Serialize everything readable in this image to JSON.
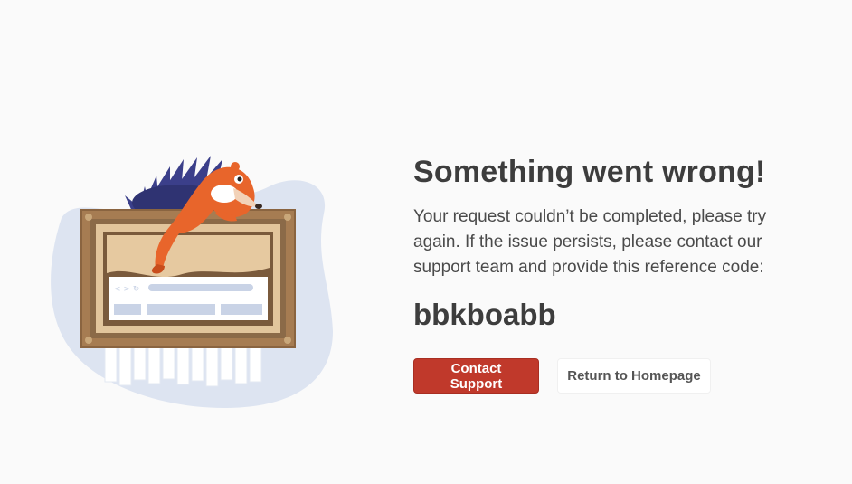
{
  "error": {
    "title": "Something went wrong!",
    "message": "Your request couldn’t be completed, please try again. If the issue persists, please contact our support team and provide this reference code:",
    "reference_code": "bbkboabb"
  },
  "actions": {
    "contact_support_label": "Contact Support",
    "return_home_label": "Return to Homepage"
  },
  "colors": {
    "background": "#fafafa",
    "primary_button": "#c0392b",
    "hedgehog_body": "#e8652b",
    "hedgehog_spines": "#3b3f8a",
    "frame": "#a67c52",
    "blob": "#dde4f1"
  },
  "illustration": {
    "icon": "hedgehog-on-frame-illustration"
  }
}
